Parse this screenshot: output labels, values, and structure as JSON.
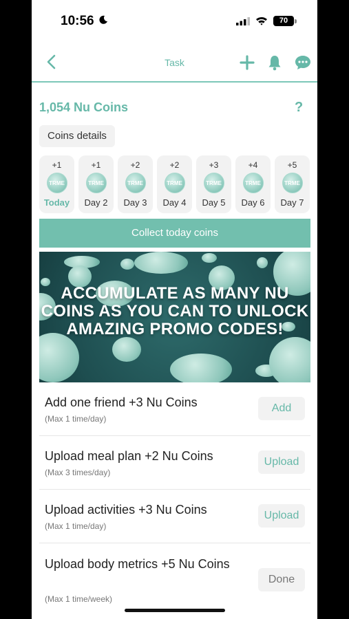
{
  "status_bar": {
    "time": "10:56",
    "battery": "70"
  },
  "nav": {
    "title": "Task"
  },
  "coins": {
    "title": "1,054 Nu Coins",
    "help": "?",
    "details_label": "Coins details"
  },
  "days": [
    {
      "plus": "+1",
      "label": "Today",
      "coin": "TRME"
    },
    {
      "plus": "+1",
      "label": "Day 2",
      "coin": "TRME"
    },
    {
      "plus": "+2",
      "label": "Day 3",
      "coin": "TRME"
    },
    {
      "plus": "+2",
      "label": "Day 4",
      "coin": "TRME"
    },
    {
      "plus": "+3",
      "label": "Day 5",
      "coin": "TRME"
    },
    {
      "plus": "+4",
      "label": "Day 6",
      "coin": "TRME"
    },
    {
      "plus": "+5",
      "label": "Day 7",
      "coin": "TRME"
    }
  ],
  "collect_label": "Collect today coins",
  "banner": {
    "text": "ACCUMULATE AS MANY NU COINS AS YOU CAN TO UNLOCK AMAZING PROMO CODES!"
  },
  "tasks": [
    {
      "name": "Add one friend +3 Nu Coins",
      "sub": "(Max 1 time/day)",
      "button": "Add"
    },
    {
      "name": "Upload meal plan +2 Nu Coins",
      "sub": "(Max 3 times/day)",
      "button": "Upload"
    },
    {
      "name": "Upload activities +3 Nu Coins",
      "sub": "(Max 1 time/day)",
      "button": "Upload"
    },
    {
      "name": "Upload body metrics +5 Nu Coins",
      "sub": "(Max 1 time/week)",
      "button": "Done"
    }
  ],
  "colors": {
    "accent": "#66b8a8",
    "button_fill": "#72bfae"
  }
}
